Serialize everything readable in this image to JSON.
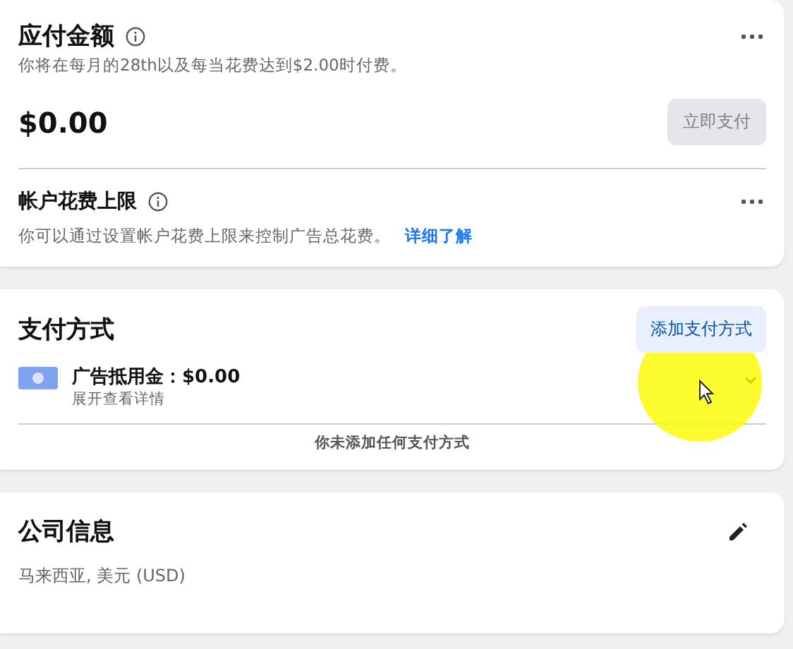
{
  "amount_due": {
    "title": "应付金额",
    "description": "你将在每月的28th以及每当花费达到$2.00时付费。",
    "amount": "$0.00",
    "pay_button": {
      "label": "立即支付",
      "disabled": true
    }
  },
  "spending_limit": {
    "title": "帐户花费上限",
    "description": "你可以通过设置帐户花费上限来控制广告总花费。",
    "link": "详细了解"
  },
  "payment_methods": {
    "title": "支付方式",
    "add_button": "添加支付方式",
    "credit": {
      "label": "广告抵用金：$0.00",
      "hint": "展开查看详情",
      "expanded": false
    },
    "empty_message": "你未添加任何支付方式"
  },
  "business_info": {
    "title": "公司信息",
    "value": "马来西亚, 美元 (USD)"
  }
}
